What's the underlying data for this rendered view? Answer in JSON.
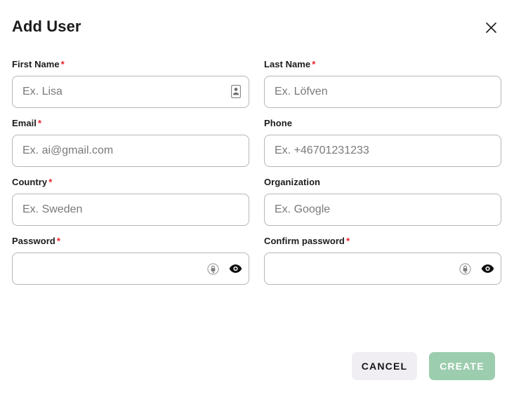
{
  "dialog": {
    "title": "Add User",
    "close_icon": "close-icon"
  },
  "fields": {
    "first_name": {
      "label": "First Name",
      "required": true,
      "required_mark": "*",
      "placeholder": "Ex. Lisa",
      "value": "",
      "trailing_icon": "contact-card-autofill-icon"
    },
    "last_name": {
      "label": "Last Name",
      "required": true,
      "required_mark": "*",
      "placeholder": "Ex. Löfven",
      "value": ""
    },
    "email": {
      "label": "Email",
      "required": true,
      "required_mark": "*",
      "placeholder": "Ex. ai@gmail.com",
      "value": ""
    },
    "phone": {
      "label": "Phone",
      "required": false,
      "required_mark": "",
      "placeholder": "Ex. +46701231233",
      "value": ""
    },
    "country": {
      "label": "Country",
      "required": true,
      "required_mark": "*",
      "placeholder": "Ex. Sweden",
      "value": ""
    },
    "organization": {
      "label": "Organization",
      "required": false,
      "required_mark": "",
      "placeholder": "Ex. Google",
      "value": ""
    },
    "password": {
      "label": "Password",
      "required": true,
      "required_mark": "*",
      "placeholder": "",
      "value": "",
      "key_icon": "key-generate-password-icon",
      "reveal_icon": "eye-show-password-icon"
    },
    "confirm_password": {
      "label": "Confirm password",
      "required": true,
      "required_mark": "*",
      "placeholder": "",
      "value": "",
      "key_icon": "key-generate-password-icon",
      "reveal_icon": "eye-show-password-icon"
    }
  },
  "footer": {
    "cancel_label": "CANCEL",
    "create_label": "CREATE"
  },
  "colors": {
    "required_star": "#ea1f29",
    "create_button_bg": "#9ccdae",
    "create_button_text": "#ffffff",
    "cancel_button_bg": "#f0eef2",
    "cancel_button_text": "#161616",
    "input_border": "#b6b6b6",
    "placeholder_text": "#7a7a7a",
    "label_text": "#1b1b1b",
    "dialog_bg": "#ffffff"
  }
}
